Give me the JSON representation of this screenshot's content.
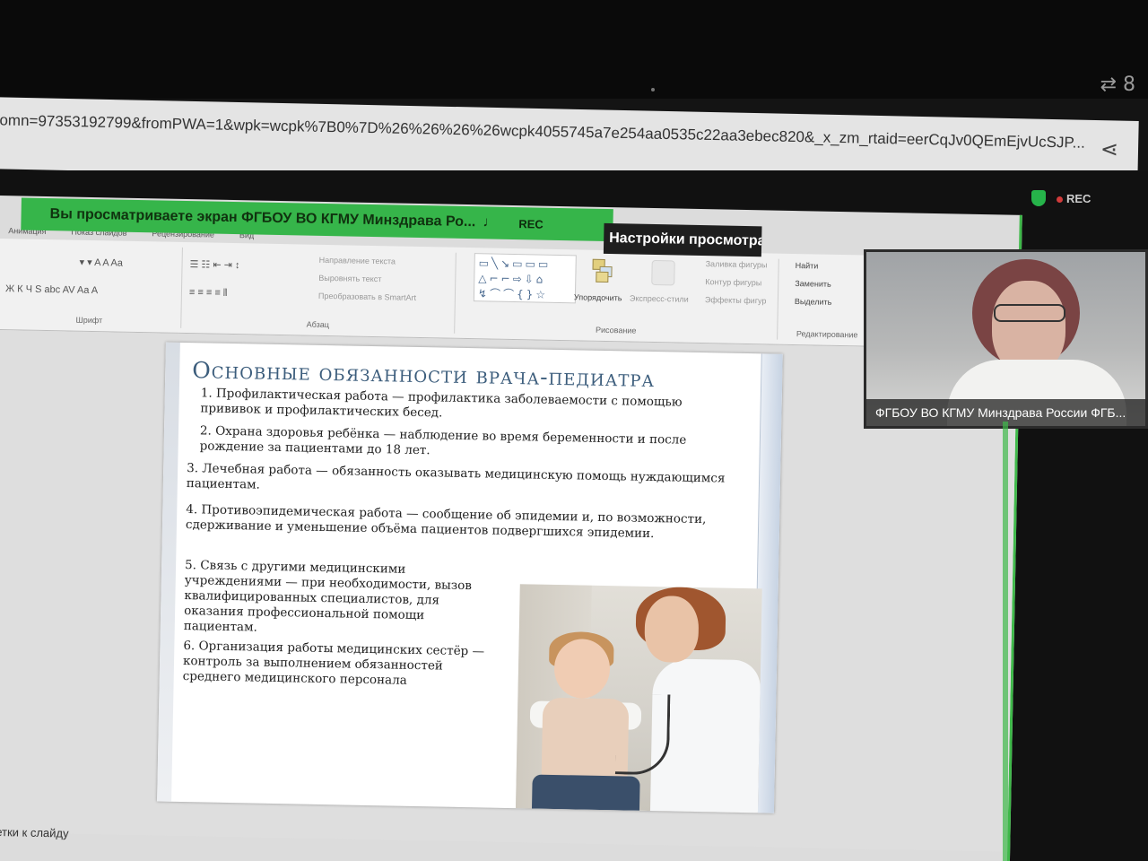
{
  "browser": {
    "status_icons": "⇄ 8",
    "url": "omn=97353192799&fromPWA=1&wpk=wcpk%7B0%7D%26%26%26%26wcpk4055745a7e254aa0535c22aa3ebec820&_x_zm_rtaid=eerCqJv0QEmEjvUcSJP..."
  },
  "zoom": {
    "share_banner": "Вы просматриваете экран  ФГБОУ ВО КГМУ Минздрава Ро...",
    "banner_rec": "REC",
    "view_settings": "Настройки просмотра",
    "top_rec": "REC",
    "webcam_label": "ФГБОУ ВО КГМУ Минздрава России ФГБ..."
  },
  "ribbon": {
    "tabs": [
      "Анимация",
      "Показ слайдов",
      "Рецензирование",
      "Вид"
    ],
    "font_group": "Шрифт",
    "paragraph_group": "Абзац",
    "drawing_group": "Рисование",
    "editing_group": "Редактирование",
    "text_direction": "Направление текста",
    "align_text": "Выровнять текст",
    "convert_smartart": "Преобразовать в SmartArt",
    "arrange": "Упорядочить",
    "quick_styles": "Экспресс-стили",
    "shape_fill": "Заливка фигуры",
    "shape_outline": "Контур фигуры",
    "shape_effects": "Эффекты фигур",
    "find": "Найти",
    "replace": "Заменить",
    "select": "Выделить",
    "font_row_1": "▾  ▾ A A  Aa",
    "font_row_2": "Ж  К  Ч  S  abc  AV  Aa  A"
  },
  "slide": {
    "title": "Основные обязанности врача-педиатра",
    "items": [
      "1.  Профилактическая работа — профилактика заболеваемости с помощью прививок и профилактических бесед.",
      "2.  Охрана здоровья ребёнка — наблюдение во время беременности и после рождение за пациентами до 18 лет.",
      "3.  Лечебная работа — обязанность оказывать медицинскую помощь нуждающимся пациентам.",
      "4. Противоэпидемическая работа — сообщение об эпидемии и, по возможности, сдерживание и уменьшение объёма пациентов подвергшихся эпидемии.",
      "5. Связь с другими медицинскими учреждениями — при необходимости, вызов квалифицированных специалистов, для оказания профессиональной помощи пациентам.",
      "6. Организация работы медицинских сестёр — контроль за выполнением обязанностей среднего медицинского персонала"
    ]
  },
  "notes_label": "метки к слайду"
}
